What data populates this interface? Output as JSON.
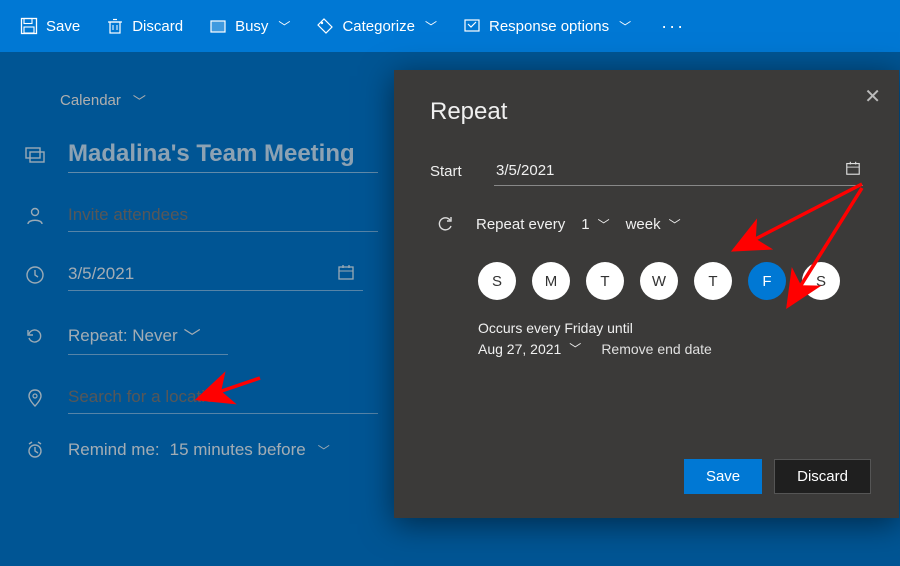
{
  "toolbar": {
    "save": "Save",
    "discard": "Discard",
    "busy": "Busy",
    "categorize": "Categorize",
    "response": "Response options"
  },
  "crumb": {
    "label": "Calendar"
  },
  "form": {
    "title": "Madalina's Team Meeting",
    "invite_placeholder": "Invite attendees",
    "date": "3/5/2021",
    "repeat_label": "Repeat:",
    "repeat_value": "Never",
    "location_placeholder": "Search for a location",
    "remind_label": "Remind me:",
    "remind_value": "15 minutes before"
  },
  "panel": {
    "title": "Repeat",
    "start_label": "Start",
    "start_date": "3/5/2021",
    "repeat_every": "Repeat every",
    "interval": "1",
    "unit": "week",
    "days": [
      "S",
      "M",
      "T",
      "W",
      "T",
      "F",
      "S"
    ],
    "selected_day_index": 5,
    "occurs": "Occurs every Friday until",
    "until": "Aug 27, 2021",
    "remove_end": "Remove end date",
    "save": "Save",
    "discard": "Discard"
  }
}
